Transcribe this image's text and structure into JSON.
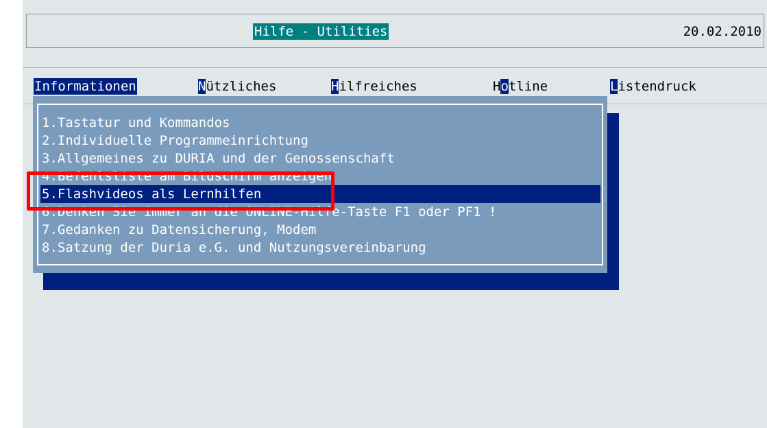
{
  "window": {
    "title": "Hilfe - Utilities",
    "date": "20.02.2010"
  },
  "menu": {
    "items": [
      {
        "hotkey": "I",
        "rest": "nformationen",
        "active": true
      },
      {
        "hotkey": "N",
        "rest": "ützliches",
        "active": false
      },
      {
        "hotkey": "H",
        "rest": "ilfreiches",
        "active": false
      },
      {
        "hotkey": "o",
        "prefix": "H",
        "rest": "tline",
        "active": false
      },
      {
        "hotkey": "L",
        "rest": "istendruck",
        "active": false
      }
    ]
  },
  "dropdown": {
    "selected_index": 4,
    "items": [
      {
        "label": "1.Tastatur und Kommandos"
      },
      {
        "label": "2.Individuelle Programmeinrichtung"
      },
      {
        "label": "3.Allgemeines zu DURIA und der Genossenschaft"
      },
      {
        "label": "4.Befehlsliste am Bildschirm anzeigen"
      },
      {
        "label": "5.Flashvideos als Lernhilfen"
      },
      {
        "label": "6.Denken Sie immer an die ONLINE-Hilfe-Taste F1 oder PF1 !"
      },
      {
        "label": "7.Gedanken zu Datensicherung, Modem"
      },
      {
        "label": "8.Satzung der Duria e.G. und Nutzungsvereinbarung"
      }
    ]
  },
  "colors": {
    "background": "#e1e6e8",
    "title_bg": "#008080",
    "menu_highlight": "#002080",
    "dropdown_bg": "#7b9bbd",
    "annotation": "#ff0000"
  }
}
